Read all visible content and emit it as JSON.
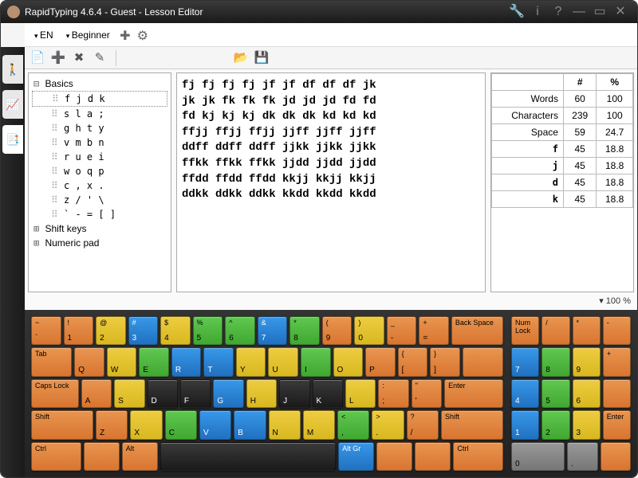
{
  "title": "RapidTyping 4.6.4 - Guest - Lesson Editor",
  "menu": {
    "lang": "EN",
    "level": "Beginner"
  },
  "sidetabs": [
    "🚶",
    "📈",
    "📑"
  ],
  "tree": {
    "root": "Basics",
    "lessons": [
      "f j d k",
      "s l a ;",
      "g h t y",
      "v m b n",
      "r u e i",
      "w o q p",
      "c , x .",
      "z / ' \\",
      "` - = [ ]"
    ],
    "folders": [
      "Shift keys",
      "Numeric pad"
    ]
  },
  "lesson_text": "fj fj fj fj jf jf df df df jk\njk jk fk fk fk jd jd jd fd fd\nfd kj kj kj dk dk dk kd kd kd\nffjj ffjj ffjj jjff jjff jjff\nddff ddff ddff jjkk jjkk jjkk\nffkk ffkk ffkk jjdd jjdd jjdd\nffdd ffdd ffdd kkjj kkjj kkjj\nddkk ddkk ddkk kkdd kkdd kkdd",
  "zoom": "▾ 100 %",
  "stats": {
    "headers": [
      "",
      "#",
      "%"
    ],
    "rows": [
      {
        "label": "Words",
        "count": "60",
        "pct": "100"
      },
      {
        "label": "Characters",
        "count": "239",
        "pct": "100"
      },
      {
        "label": "Space",
        "count": "59",
        "pct": "24.7"
      },
      {
        "label": "f",
        "count": "45",
        "pct": "18.8",
        "bold": true
      },
      {
        "label": "j",
        "count": "45",
        "pct": "18.8",
        "bold": true
      },
      {
        "label": "d",
        "count": "45",
        "pct": "18.8",
        "bold": true
      },
      {
        "label": "k",
        "count": "45",
        "pct": "18.8",
        "bold": true
      }
    ]
  },
  "kb": {
    "r1": [
      {
        "t": "~",
        "b": "`",
        "c": "or",
        "w": "w1"
      },
      {
        "t": "!",
        "b": "1",
        "c": "or",
        "w": "w1"
      },
      {
        "t": "@",
        "b": "2",
        "c": "ye",
        "w": "w1"
      },
      {
        "t": "#",
        "b": "3",
        "c": "bl",
        "w": "w1"
      },
      {
        "t": "$",
        "b": "4",
        "c": "ye",
        "w": "w1"
      },
      {
        "t": "%",
        "b": "5",
        "c": "gr",
        "w": "w1"
      },
      {
        "t": "^",
        "b": "6",
        "c": "gr",
        "w": "w1"
      },
      {
        "t": "&",
        "b": "7",
        "c": "bl",
        "w": "w1"
      },
      {
        "t": "*",
        "b": "8",
        "c": "gr",
        "w": "w1"
      },
      {
        "t": "(",
        "b": "9",
        "c": "or",
        "w": "w1"
      },
      {
        "t": ")",
        "b": "0",
        "c": "ye",
        "w": "w1"
      },
      {
        "t": "_",
        "b": "-",
        "c": "or",
        "w": "w1"
      },
      {
        "t": "+",
        "b": "=",
        "c": "or",
        "w": "w1"
      },
      {
        "t": "Back Space",
        "b": "",
        "c": "or",
        "w": "w2"
      }
    ],
    "r2": [
      {
        "t": "Tab",
        "b": "",
        "c": "or",
        "w": "w15"
      },
      {
        "t": "",
        "b": "Q",
        "c": "or",
        "w": "w1"
      },
      {
        "t": "",
        "b": "W",
        "c": "ye",
        "w": "w1"
      },
      {
        "t": "",
        "b": "E",
        "c": "gr",
        "w": "w1"
      },
      {
        "t": "",
        "b": "R",
        "c": "bl",
        "w": "w1"
      },
      {
        "t": "",
        "b": "T",
        "c": "bl",
        "w": "w1"
      },
      {
        "t": "",
        "b": "Y",
        "c": "ye",
        "w": "w1"
      },
      {
        "t": "",
        "b": "U",
        "c": "ye",
        "w": "w1"
      },
      {
        "t": "",
        "b": "I",
        "c": "gr",
        "w": "w1"
      },
      {
        "t": "",
        "b": "O",
        "c": "ye",
        "w": "w1"
      },
      {
        "t": "",
        "b": "P",
        "c": "or",
        "w": "w1"
      },
      {
        "t": "{",
        "b": "[",
        "c": "or",
        "w": "w1"
      },
      {
        "t": "}",
        "b": "]",
        "c": "or",
        "w": "w1"
      },
      {
        "t": "",
        "b": "",
        "c": "or",
        "w": "w15"
      }
    ],
    "r3": [
      {
        "t": "Caps Lock",
        "b": "",
        "c": "or",
        "w": "w175"
      },
      {
        "t": "",
        "b": "A",
        "c": "or",
        "w": "w1"
      },
      {
        "t": "",
        "b": "S",
        "c": "ye",
        "w": "w1"
      },
      {
        "t": "",
        "b": "D",
        "c": "bk",
        "w": "w1"
      },
      {
        "t": "",
        "b": "F",
        "c": "bk",
        "w": "w1"
      },
      {
        "t": "",
        "b": "G",
        "c": "bl",
        "w": "w1"
      },
      {
        "t": "",
        "b": "H",
        "c": "ye",
        "w": "w1"
      },
      {
        "t": "",
        "b": "J",
        "c": "bk",
        "w": "w1"
      },
      {
        "t": "",
        "b": "K",
        "c": "bk",
        "w": "w1"
      },
      {
        "t": "",
        "b": "L",
        "c": "ye",
        "w": "w1"
      },
      {
        "t": ":",
        "b": ";",
        "c": "or",
        "w": "w1"
      },
      {
        "t": "\"",
        "b": "'",
        "c": "or",
        "w": "w1"
      },
      {
        "t": "Enter",
        "b": "",
        "c": "or",
        "w": "w225"
      }
    ],
    "r4": [
      {
        "t": "Shift",
        "b": "",
        "c": "or",
        "w": "w225"
      },
      {
        "t": "",
        "b": "Z",
        "c": "or",
        "w": "w1"
      },
      {
        "t": "",
        "b": "X",
        "c": "ye",
        "w": "w1"
      },
      {
        "t": "",
        "b": "C",
        "c": "gr",
        "w": "w1"
      },
      {
        "t": "",
        "b": "V",
        "c": "bl",
        "w": "w1"
      },
      {
        "t": "",
        "b": "B",
        "c": "bl",
        "w": "w1"
      },
      {
        "t": "",
        "b": "N",
        "c": "ye",
        "w": "w1"
      },
      {
        "t": "",
        "b": "M",
        "c": "ye",
        "w": "w1"
      },
      {
        "t": "<",
        "b": ",",
        "c": "gr",
        "w": "w1"
      },
      {
        "t": ">",
        "b": ".",
        "c": "ye",
        "w": "w1"
      },
      {
        "t": "?",
        "b": "/",
        "c": "or",
        "w": "w1"
      },
      {
        "t": "Shift",
        "b": "",
        "c": "or",
        "w": "w225"
      }
    ],
    "r5": [
      {
        "t": "Ctrl",
        "b": "",
        "c": "or",
        "w": "w15"
      },
      {
        "t": "",
        "b": "",
        "c": "or",
        "w": "w1"
      },
      {
        "t": "Alt",
        "b": "",
        "c": "or",
        "w": "w1"
      },
      {
        "t": "",
        "b": "",
        "c": "bk",
        "w": "w6"
      },
      {
        "t": "Alt Gr",
        "b": "",
        "c": "bl",
        "w": "w1"
      },
      {
        "t": "",
        "b": "",
        "c": "or",
        "w": "w1"
      },
      {
        "t": "",
        "b": "",
        "c": "or",
        "w": "w1"
      },
      {
        "t": "Ctrl",
        "b": "",
        "c": "or",
        "w": "w15"
      }
    ],
    "np": [
      [
        {
          "t": "Num Lock",
          "b": "",
          "c": "or",
          "w": "w1"
        },
        {
          "t": "/",
          "b": "",
          "c": "or",
          "w": "w1"
        },
        {
          "t": "*",
          "b": "",
          "c": "or",
          "w": "w1"
        },
        {
          "t": "-",
          "b": "",
          "c": "or",
          "w": "w1"
        }
      ],
      [
        {
          "t": "",
          "b": "7",
          "c": "bl",
          "w": "w1"
        },
        {
          "t": "",
          "b": "8",
          "c": "gr",
          "w": "w1"
        },
        {
          "t": "",
          "b": "9",
          "c": "ye",
          "w": "w1"
        },
        {
          "t": "+",
          "b": "",
          "c": "or",
          "w": "w1"
        }
      ],
      [
        {
          "t": "",
          "b": "4",
          "c": "bl",
          "w": "w1"
        },
        {
          "t": "",
          "b": "5",
          "c": "gr",
          "w": "w1"
        },
        {
          "t": "",
          "b": "6",
          "c": "ye",
          "w": "w1"
        },
        {
          "t": "",
          "b": "",
          "c": "or",
          "w": "w1"
        }
      ],
      [
        {
          "t": "",
          "b": "1",
          "c": "bl",
          "w": "w1"
        },
        {
          "t": "",
          "b": "2",
          "c": "gr",
          "w": "w1"
        },
        {
          "t": "",
          "b": "3",
          "c": "ye",
          "w": "w1"
        },
        {
          "t": "Enter",
          "b": "",
          "c": "or",
          "w": "w1"
        }
      ],
      [
        {
          "t": "",
          "b": "0",
          "c": "gy",
          "w": "w2"
        },
        {
          "t": "",
          "b": ".",
          "c": "gy",
          "w": "w1"
        },
        {
          "t": "",
          "b": "",
          "c": "or",
          "w": "w1"
        }
      ]
    ]
  }
}
